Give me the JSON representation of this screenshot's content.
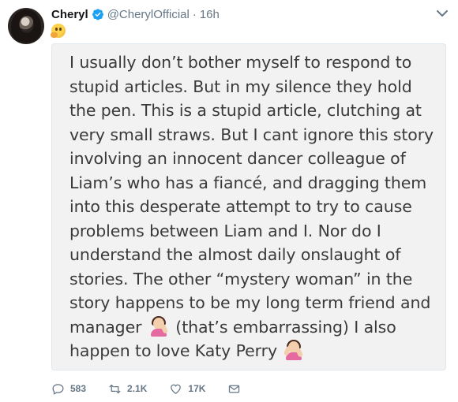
{
  "tweet": {
    "author_name": "Cheryl",
    "handle": "@CherylOfficial",
    "separator": "·",
    "time": "16h",
    "body_emoji_icon": "thinking-face-emoji",
    "image_text_lines": [
      "I usually don’t bother myself to respond to",
      "stupid articles. But in my silence they hold",
      "the pen. This is a stupid article, clutching at",
      "very small straws. But I cant ignore this story",
      "involving an innocent dancer colleague of",
      "Liam’s who has a fiancé, and dragging them",
      "into this desperate attempt to try to cause",
      "problems between Liam and I. Nor do I",
      "understand the almost daily onslaught of",
      "stories. The other “mystery woman” in the",
      "story happens to be my long term friend and"
    ],
    "line12_before": "manager",
    "line12_after": "(that’s embarrassing) I also",
    "line13_before": "happen to love Katy Perry",
    "actions": {
      "replies": "583",
      "retweets": "2.1K",
      "likes": "17K"
    },
    "icons": {
      "verified": "verified-badge-icon",
      "caret": "chevron-down-icon",
      "reply": "reply-icon",
      "retweet": "retweet-icon",
      "like": "heart-icon",
      "dm": "envelope-icon"
    },
    "colors": {
      "verified": "#1da1f2",
      "muted": "#657786",
      "text": "#14171a",
      "image_bg": "#f2f2f2"
    }
  }
}
